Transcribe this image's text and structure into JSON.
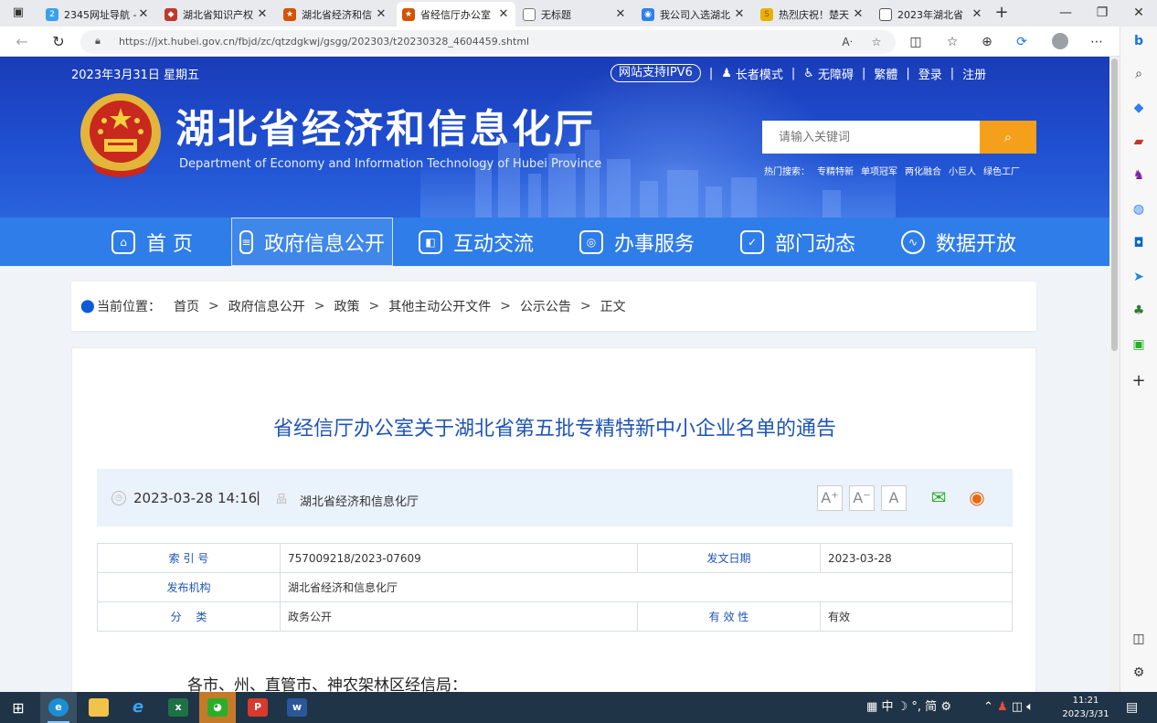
{
  "browser": {
    "tabs": [
      {
        "title": "2345网址导航 -",
        "fav_color": "#3aa0e8",
        "fav_glyph": "2"
      },
      {
        "title": "湖北省知识产权",
        "fav_color": "#c0392b",
        "fav_glyph": "♦"
      },
      {
        "title": "湖北省经济和信",
        "fav_color": "#d35400",
        "fav_glyph": "★"
      },
      {
        "title": "省经信厅办公室",
        "fav_color": "#d35400",
        "fav_glyph": "★"
      },
      {
        "title": "无标题",
        "fav_color": "#ffffff",
        "fav_glyph": "▢"
      },
      {
        "title": "我公司入选湖北",
        "fav_color": "#2f80ed",
        "fav_glyph": "◉"
      },
      {
        "title": "热烈庆祝！楚天",
        "fav_color": "#e2b400",
        "fav_glyph": "S"
      },
      {
        "title": "2023年湖北省",
        "fav_color": "#ffffff",
        "fav_glyph": "▢"
      }
    ],
    "url": "https://jxt.hubei.gov.cn/fbjd/zc/qtzdgkwj/gsgg/202303/t20230328_4604459.shtml",
    "address_icons": [
      "read-aloud-icon",
      "favorite-star-icon"
    ],
    "toolbar_icons": [
      "split-screen-icon",
      "favorites-icon",
      "collections-icon",
      "edge-icon",
      "profile-icon",
      "more-icon"
    ],
    "sidebar_icons": [
      "bing-icon",
      "search-icon",
      "shopping-icon",
      "tools-icon",
      "games-icon",
      "office-icon",
      "outlook-icon",
      "telegram-icon",
      "tree-icon",
      "wechat-icon",
      "add-icon",
      "sidebar-toggle-icon",
      "settings-icon"
    ]
  },
  "site": {
    "date": "2023年3月31日 星期五",
    "ipv6": "网站支持IPV6",
    "elder_mode": "长者模式",
    "accessible": "无障碍",
    "traditional": "繁體",
    "login": "登录",
    "register": "注册",
    "title": "湖北省经济和信息化厅",
    "title_en": "Department of Economy and Information Technology of Hubei Province",
    "search_placeholder": "请输入关键词",
    "hot_label": "热门搜索：",
    "hot_terms": [
      "专精特新",
      "单项冠军",
      "两化融合",
      "小巨人",
      "绿色工厂"
    ],
    "colors": {
      "banner": "#1f4fd0",
      "nav": "#2f7de8",
      "accent": "#f5a01a",
      "title_blue": "#1e55b5"
    }
  },
  "nav": [
    {
      "label": "首 页",
      "icon": "home-icon"
    },
    {
      "label": "政府信息公开",
      "icon": "info-open-icon"
    },
    {
      "label": "互动交流",
      "icon": "interaction-icon"
    },
    {
      "label": "办事服务",
      "icon": "service-icon"
    },
    {
      "label": "部门动态",
      "icon": "news-icon"
    },
    {
      "label": "数据开放",
      "icon": "data-icon"
    }
  ],
  "breadcrumb": {
    "label": "当前位置：",
    "items": [
      "首页",
      "政府信息公开",
      "政策",
      "其他主动公开文件",
      "公示公告",
      "正文"
    ]
  },
  "article": {
    "title": "省经信厅办公室关于湖北省第五批专精特新中小企业名单的通告",
    "datetime": "2023-03-28 14:16",
    "org": "湖北省经济和信息化厅",
    "font_buttons": [
      "A⁺",
      "A⁻",
      "A"
    ],
    "table": {
      "index_label": "索 引 号",
      "index_value": "757009218/2023-07609",
      "date_label": "发文日期",
      "date_value": "2023-03-28",
      "publisher_label": "发布机构",
      "publisher_value": "湖北省经济和信息化厅",
      "category_label": "分　 类",
      "category_value": "政务公开",
      "validity_label": "有 效 性",
      "validity_value": "有效"
    },
    "body_first_line": "各市、州、直管市、神农架林区经信局："
  },
  "taskbar": {
    "ime": "中",
    "ime2": "简",
    "time": "11:21",
    "date": "2023/3/31"
  }
}
